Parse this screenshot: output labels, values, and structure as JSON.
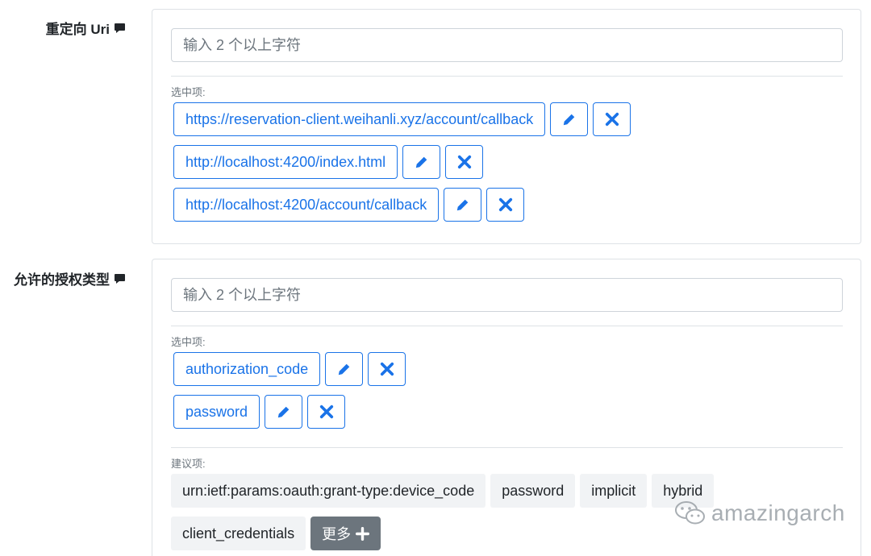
{
  "redirect": {
    "label": "重定向 Uri",
    "placeholder": "输入 2 个以上字符",
    "selected_caption": "选中项:",
    "selected": [
      "https://reservation-client.weihanli.xyz/account/callback",
      "http://localhost:4200/index.html",
      "http://localhost:4200/account/callback"
    ]
  },
  "grant": {
    "label": "允许的授权类型",
    "placeholder": "输入 2 个以上字符",
    "selected_caption": "选中项:",
    "selected": [
      "authorization_code",
      "password"
    ],
    "suggest_caption": "建议项:",
    "suggestions": [
      "urn:ietf:params:oauth:grant-type:device_code",
      "password",
      "implicit",
      "hybrid",
      "client_credentials"
    ],
    "more_label": "更多"
  },
  "watermark": {
    "text": "amazingarch"
  },
  "colors": {
    "primary": "#1a73e8",
    "secondary": "#6c757d",
    "border": "#dee2e6"
  },
  "icons": {
    "edit": "pencil-icon",
    "remove": "times-icon",
    "more": "plus-icon",
    "label_hint": "comment-icon",
    "watermark": "wechat-icon"
  }
}
